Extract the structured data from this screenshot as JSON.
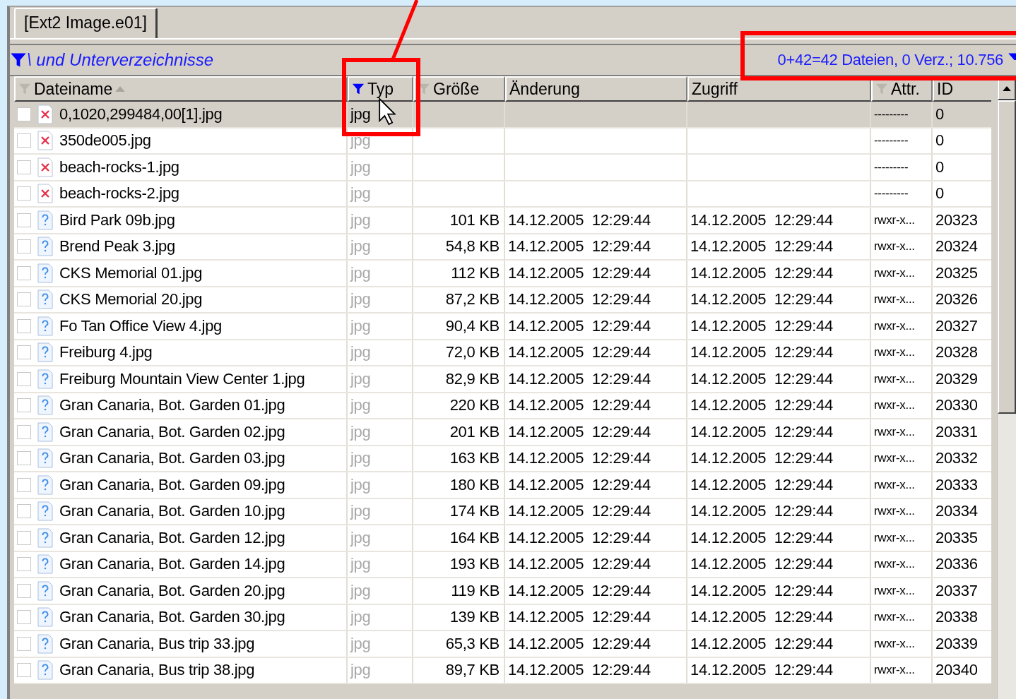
{
  "tabs": [
    {
      "label": "[Ext2 Image.e01]",
      "selected": true
    }
  ],
  "filter_bar": {
    "path": "\\ und Unterverzeichnisse",
    "summary": "0+42=42 Dateien, 0 Verz.; 10.756"
  },
  "columns": [
    {
      "label": "Dateiname",
      "filter_icon": true,
      "filter_active": false,
      "sorted": true
    },
    {
      "label": "Typ",
      "filter_icon": true,
      "filter_active": true,
      "sorted": false
    },
    {
      "label": "Größe",
      "filter_icon": true,
      "filter_active": false,
      "sorted": false
    },
    {
      "label": "Änderung",
      "filter_icon": false,
      "filter_active": false,
      "sorted": false
    },
    {
      "label": "Zugriff",
      "filter_icon": false,
      "filter_active": false,
      "sorted": false
    },
    {
      "label": "Attr.",
      "filter_icon": true,
      "filter_active": false,
      "sorted": false
    },
    {
      "label": "ID",
      "filter_icon": false,
      "filter_active": false,
      "sorted": false
    }
  ],
  "rows": [
    {
      "name": "0,1020,299484,00[1].jpg",
      "kind": "deleted",
      "type": "jpg",
      "size": "",
      "modified": "",
      "accessed": "",
      "attr": "---------",
      "id": "0",
      "selected": true,
      "checked": false
    },
    {
      "name": "350de005.jpg",
      "kind": "deleted",
      "type": "jpg",
      "size": "",
      "modified": "",
      "accessed": "",
      "attr": "---------",
      "id": "0",
      "selected": false,
      "checked": false
    },
    {
      "name": "beach-rocks-1.jpg",
      "kind": "deleted",
      "type": "jpg",
      "size": "",
      "modified": "",
      "accessed": "",
      "attr": "---------",
      "id": "0",
      "selected": false,
      "checked": false
    },
    {
      "name": "beach-rocks-2.jpg",
      "kind": "deleted",
      "type": "jpg",
      "size": "",
      "modified": "",
      "accessed": "",
      "attr": "---------",
      "id": "0",
      "selected": false,
      "checked": false
    },
    {
      "name": "Bird Park 09b.jpg",
      "kind": "unknown",
      "type": "jpg",
      "size": "101 KB",
      "modified": "14.12.2005  12:29:44",
      "accessed": "14.12.2005  12:29:44",
      "attr": "rwxr-x...",
      "id": "20323",
      "selected": false,
      "checked": false
    },
    {
      "name": "Brend Peak 3.jpg",
      "kind": "unknown",
      "type": "jpg",
      "size": "54,8 KB",
      "modified": "14.12.2005  12:29:44",
      "accessed": "14.12.2005  12:29:44",
      "attr": "rwxr-x...",
      "id": "20324",
      "selected": false,
      "checked": false
    },
    {
      "name": "CKS Memorial 01.jpg",
      "kind": "unknown",
      "type": "jpg",
      "size": "112 KB",
      "modified": "14.12.2005  12:29:44",
      "accessed": "14.12.2005  12:29:44",
      "attr": "rwxr-x...",
      "id": "20325",
      "selected": false,
      "checked": false
    },
    {
      "name": "CKS Memorial 20.jpg",
      "kind": "unknown",
      "type": "jpg",
      "size": "87,2 KB",
      "modified": "14.12.2005  12:29:44",
      "accessed": "14.12.2005  12:29:44",
      "attr": "rwxr-x...",
      "id": "20326",
      "selected": false,
      "checked": false
    },
    {
      "name": "Fo Tan Office View 4.jpg",
      "kind": "unknown",
      "type": "jpg",
      "size": "90,4 KB",
      "modified": "14.12.2005  12:29:44",
      "accessed": "14.12.2005  12:29:44",
      "attr": "rwxr-x...",
      "id": "20327",
      "selected": false,
      "checked": false
    },
    {
      "name": "Freiburg 4.jpg",
      "kind": "unknown",
      "type": "jpg",
      "size": "72,0 KB",
      "modified": "14.12.2005  12:29:44",
      "accessed": "14.12.2005  12:29:44",
      "attr": "rwxr-x...",
      "id": "20328",
      "selected": false,
      "checked": false
    },
    {
      "name": "Freiburg Mountain View Center 1.jpg",
      "kind": "unknown",
      "type": "jpg",
      "size": "82,9 KB",
      "modified": "14.12.2005  12:29:44",
      "accessed": "14.12.2005  12:29:44",
      "attr": "rwxr-x...",
      "id": "20329",
      "selected": false,
      "checked": false
    },
    {
      "name": "Gran Canaria, Bot. Garden 01.jpg",
      "kind": "unknown",
      "type": "jpg",
      "size": "220 KB",
      "modified": "14.12.2005  12:29:44",
      "accessed": "14.12.2005  12:29:44",
      "attr": "rwxr-x...",
      "id": "20330",
      "selected": false,
      "checked": false
    },
    {
      "name": "Gran Canaria, Bot. Garden 02.jpg",
      "kind": "unknown",
      "type": "jpg",
      "size": "201 KB",
      "modified": "14.12.2005  12:29:44",
      "accessed": "14.12.2005  12:29:44",
      "attr": "rwxr-x...",
      "id": "20331",
      "selected": false,
      "checked": false
    },
    {
      "name": "Gran Canaria, Bot. Garden 03.jpg",
      "kind": "unknown",
      "type": "jpg",
      "size": "163 KB",
      "modified": "14.12.2005  12:29:44",
      "accessed": "14.12.2005  12:29:44",
      "attr": "rwxr-x...",
      "id": "20332",
      "selected": false,
      "checked": false
    },
    {
      "name": "Gran Canaria, Bot. Garden 09.jpg",
      "kind": "unknown",
      "type": "jpg",
      "size": "180 KB",
      "modified": "14.12.2005  12:29:44",
      "accessed": "14.12.2005  12:29:44",
      "attr": "rwxr-x...",
      "id": "20333",
      "selected": false,
      "checked": false
    },
    {
      "name": "Gran Canaria, Bot. Garden 10.jpg",
      "kind": "unknown",
      "type": "jpg",
      "size": "174 KB",
      "modified": "14.12.2005  12:29:44",
      "accessed": "14.12.2005  12:29:44",
      "attr": "rwxr-x...",
      "id": "20334",
      "selected": false,
      "checked": false
    },
    {
      "name": "Gran Canaria, Bot. Garden 12.jpg",
      "kind": "unknown",
      "type": "jpg",
      "size": "164 KB",
      "modified": "14.12.2005  12:29:44",
      "accessed": "14.12.2005  12:29:44",
      "attr": "rwxr-x...",
      "id": "20335",
      "selected": false,
      "checked": false
    },
    {
      "name": "Gran Canaria, Bot. Garden 14.jpg",
      "kind": "unknown",
      "type": "jpg",
      "size": "193 KB",
      "modified": "14.12.2005  12:29:44",
      "accessed": "14.12.2005  12:29:44",
      "attr": "rwxr-x...",
      "id": "20336",
      "selected": false,
      "checked": false
    },
    {
      "name": "Gran Canaria, Bot. Garden 20.jpg",
      "kind": "unknown",
      "type": "jpg",
      "size": "119 KB",
      "modified": "14.12.2005  12:29:44",
      "accessed": "14.12.2005  12:29:44",
      "attr": "rwxr-x...",
      "id": "20337",
      "selected": false,
      "checked": false
    },
    {
      "name": "Gran Canaria, Bot. Garden 30.jpg",
      "kind": "unknown",
      "type": "jpg",
      "size": "139 KB",
      "modified": "14.12.2005  12:29:44",
      "accessed": "14.12.2005  12:29:44",
      "attr": "rwxr-x...",
      "id": "20338",
      "selected": false,
      "checked": false
    },
    {
      "name": "Gran Canaria, Bus trip 33.jpg",
      "kind": "unknown",
      "type": "jpg",
      "size": "65,3 KB",
      "modified": "14.12.2005  12:29:44",
      "accessed": "14.12.2005  12:29:44",
      "attr": "rwxr-x...",
      "id": "20339",
      "selected": false,
      "checked": false
    },
    {
      "name": "Gran Canaria, Bus trip 38.jpg",
      "kind": "unknown",
      "type": "jpg",
      "size": "89,7 KB",
      "modified": "14.12.2005  12:29:44",
      "accessed": "14.12.2005  12:29:44",
      "attr": "rwxr-x...",
      "id": "20340",
      "selected": false,
      "checked": false
    }
  ]
}
